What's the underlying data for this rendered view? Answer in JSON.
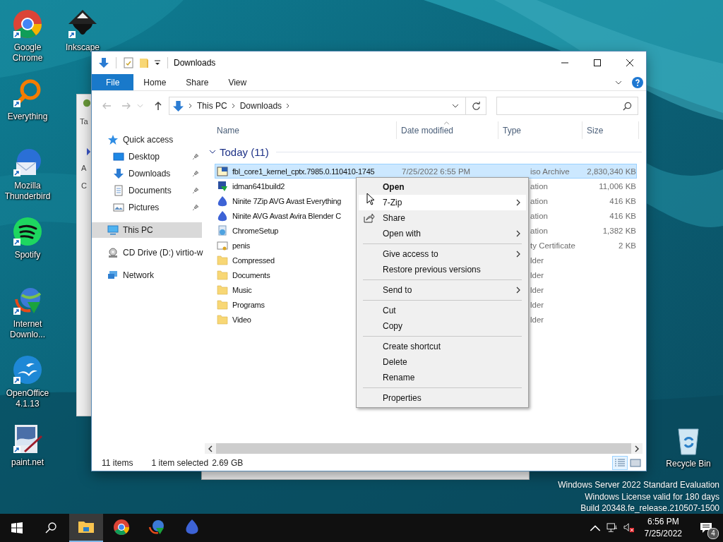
{
  "desktop_icons": [
    {
      "label": "Google Chrome",
      "kind": "chrome"
    },
    {
      "label": "Everything",
      "kind": "everything"
    },
    {
      "label": "Mozilla Thunderbird",
      "kind": "thunderbird"
    },
    {
      "label": "Spotify",
      "kind": "spotify"
    },
    {
      "label": "Internet Downlo...",
      "kind": "idm"
    },
    {
      "label": "OpenOffice 4.1.13",
      "kind": "openoffice"
    },
    {
      "label": "paint.net",
      "kind": "paint"
    },
    {
      "label": "Inkscape",
      "kind": "inkscape"
    }
  ],
  "recycle_bin": {
    "label": "Recycle Bin"
  },
  "window_behind": {
    "fragments": [
      "Ta",
      "A",
      "C"
    ]
  },
  "explorer": {
    "title": "Downloads",
    "ribbon_tabs": [
      {
        "label": "File",
        "selected": true
      },
      {
        "label": "Home",
        "selected": false
      },
      {
        "label": "Share",
        "selected": false
      },
      {
        "label": "View",
        "selected": false
      }
    ],
    "breadcrumb": [
      "This PC",
      "Downloads"
    ],
    "navigation": [
      {
        "label": "Quick access",
        "kind": "star",
        "selected": false,
        "children": [
          {
            "label": "Desktop",
            "kind": "desktop",
            "pinned": true,
            "selected": false
          },
          {
            "label": "Downloads",
            "kind": "download",
            "pinned": true,
            "selected": false
          },
          {
            "label": "Documents",
            "kind": "document",
            "pinned": true,
            "selected": false
          },
          {
            "label": "Pictures",
            "kind": "pictures",
            "pinned": true,
            "selected": false
          }
        ]
      },
      {
        "label": "This PC",
        "kind": "pc",
        "selected": true
      },
      {
        "label": "CD Drive (D:) virtio-w",
        "kind": "cd",
        "selected": false
      },
      {
        "label": "Network",
        "kind": "network",
        "selected": false
      }
    ],
    "columns": [
      {
        "label": "Name",
        "sorted": false
      },
      {
        "label": "Date modified",
        "sorted": true
      },
      {
        "label": "Type",
        "sorted": false
      },
      {
        "label": "Size",
        "sorted": false
      }
    ],
    "group": {
      "label": "Today (11)",
      "expanded": true
    },
    "rows": [
      {
        "name": "fbl_core1_kernel_cptx.7985.0.110410-1745",
        "date": "7/25/2022 6:55 PM",
        "type": "iso Archive",
        "size": "2,830,340 KB",
        "kind": "iso",
        "selected": true
      },
      {
        "name": "idman641build2",
        "type": "ation",
        "size": "11,006 KB",
        "kind": "installer",
        "selected": false
      },
      {
        "name": "Ninite 7Zip AVG Avast Everything",
        "type": "ation",
        "size": "416 KB",
        "kind": "ninite",
        "selected": false
      },
      {
        "name": "Ninite AVG Avast Avira Blender C",
        "type": "ation",
        "size": "416 KB",
        "kind": "ninite",
        "selected": false
      },
      {
        "name": "ChromeSetup",
        "type": "ation",
        "size": "1,382 KB",
        "kind": "setup",
        "selected": false
      },
      {
        "name": "penis",
        "type": "ty Certificate",
        "size": "2 KB",
        "kind": "certificate",
        "selected": false
      },
      {
        "name": "Compressed",
        "type": "lder",
        "kind": "folder",
        "selected": false
      },
      {
        "name": "Documents",
        "type": "lder",
        "kind": "folder",
        "selected": false
      },
      {
        "name": "Music",
        "type": "lder",
        "kind": "folder",
        "selected": false
      },
      {
        "name": "Programs",
        "type": "lder",
        "kind": "folder",
        "selected": false
      },
      {
        "name": "Video",
        "type": "lder",
        "kind": "folder",
        "selected": false
      }
    ],
    "status": {
      "count": "11 items",
      "selection": "1 item selected",
      "size": "2.69 GB"
    },
    "view_buttons": [
      {
        "kind": "details",
        "selected": true
      },
      {
        "kind": "large",
        "selected": false
      }
    ]
  },
  "context_menu": [
    {
      "kind": "command",
      "label": "Open",
      "bold": true,
      "selected": false
    },
    {
      "kind": "submenu",
      "label": "7-Zip",
      "bold": false,
      "selected": true
    },
    {
      "kind": "share",
      "label": "Share",
      "bold": false,
      "selected": false
    },
    {
      "kind": "submenu",
      "label": "Open with",
      "bold": false,
      "selected": false
    },
    {
      "kind": "separator"
    },
    {
      "kind": "submenu",
      "label": "Give access to",
      "bold": false,
      "selected": false
    },
    {
      "kind": "command",
      "label": "Restore previous versions",
      "bold": false,
      "selected": false
    },
    {
      "kind": "separator"
    },
    {
      "kind": "submenu",
      "label": "Send to",
      "bold": false,
      "selected": false
    },
    {
      "kind": "separator"
    },
    {
      "kind": "command",
      "label": "Cut",
      "bold": false,
      "selected": false
    },
    {
      "kind": "command",
      "label": "Copy",
      "bold": false,
      "selected": false
    },
    {
      "kind": "separator"
    },
    {
      "kind": "command",
      "label": "Create shortcut",
      "bold": false,
      "selected": false
    },
    {
      "kind": "command",
      "label": "Delete",
      "bold": false,
      "selected": false
    },
    {
      "kind": "command",
      "label": "Rename",
      "bold": false,
      "selected": false
    },
    {
      "kind": "separator"
    },
    {
      "kind": "command",
      "label": "Properties",
      "bold": false,
      "selected": false
    }
  ],
  "os_notice": [
    "Windows Server 2022 Standard Evaluation",
    "Windows License valid for 180 days",
    "Build 20348.fe_release.210507-1500"
  ],
  "taskbar": {
    "apps": [
      {
        "kind": "explorer",
        "active": true
      },
      {
        "kind": "chrome",
        "active": false
      },
      {
        "kind": "idm",
        "active": false
      },
      {
        "kind": "ninite",
        "active": false
      }
    ],
    "tray": {
      "muted": true,
      "time": "6:56 PM",
      "date": "7/25/2022",
      "notifications": "4"
    }
  }
}
